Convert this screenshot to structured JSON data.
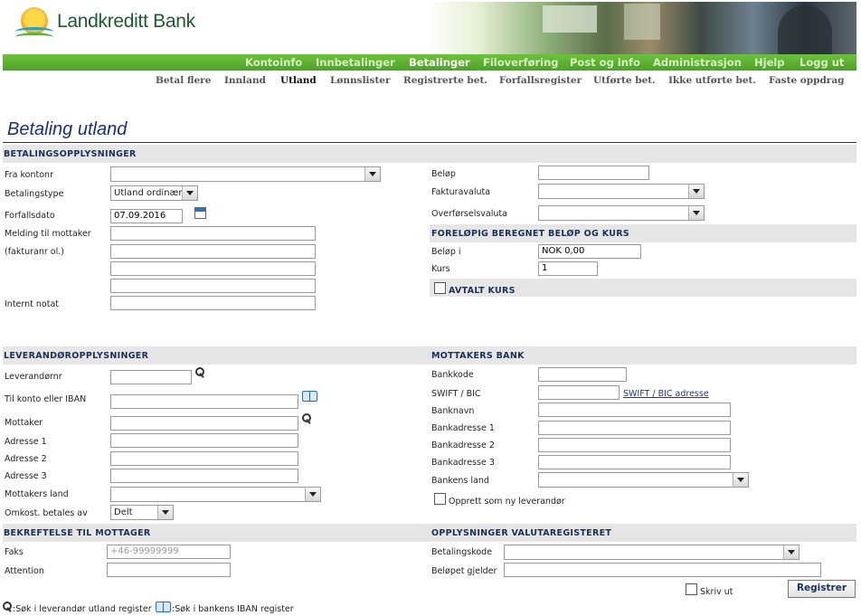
{
  "brand": {
    "name": "Landkreditt Bank"
  },
  "main_nav": [
    "Kontoinfo",
    "Innbetalinger",
    "Betalinger",
    "Filoverføring",
    "Post og info",
    "Administrasjon",
    "Hjelp",
    "Logg ut"
  ],
  "main_nav_active": "Betalinger",
  "sub_nav": [
    "Betal flere",
    "Innland",
    "Utland",
    "Lønnslister",
    "Registrerte bet.",
    "Forfallsregister",
    "Utførte bet.",
    "Ikke utførte bet.",
    "Faste oppdrag"
  ],
  "sub_nav_active": "Utland",
  "page_title": "Betaling utland",
  "betalingsopplysninger": {
    "title": "BETALINGSOPPLYSNINGER",
    "fra_kontonr_label": "Fra kontonr",
    "fra_kontonr_value": "",
    "betalingstype_label": "Betalingstype",
    "betalingstype_value": "Utland ordinær",
    "forfallsdato_label": "Forfallsdato",
    "forfallsdato_value": "07.09.2016",
    "melding_label_1": "Melding til mottaker",
    "melding_label_2": "(fakturanr ol.)",
    "internt_notat_label": "Internt notat",
    "belop_label": "Beløp",
    "fakturavaluta_label": "Fakturavaluta",
    "overforselsvaluta_label": "Overførselsvaluta"
  },
  "forelopig": {
    "title": "FORELØPIG BEREGNET BELØP OG KURS",
    "belop_i_label": "Beløp i",
    "belop_i_value": "NOK 0,00",
    "kurs_label": "Kurs",
    "kurs_value": "1",
    "avtalt_kurs_label": "AVTALT KURS"
  },
  "leverandor": {
    "title": "LEVERANDØROPPLYSNINGER",
    "leverandornr_label": "Leverandørnr",
    "til_konto_label": "Til konto eller IBAN",
    "mottaker_label": "Mottaker",
    "adresse1_label": "Adresse 1",
    "adresse2_label": "Adresse 2",
    "adresse3_label": "Adresse 3",
    "mottakers_land_label": "Mottakers land",
    "omkost_label": "Omkost. betales av",
    "omkost_value": "Delt"
  },
  "mottakers_bank": {
    "title": "MOTTAKERS BANK",
    "bankkode_label": "Bankkode",
    "swift_label": "SWIFT / BIC",
    "swift_link": "SWIFT / BIC adresse",
    "banknavn_label": "Banknavn",
    "bankadresse1_label": "Bankadresse 1",
    "bankadresse2_label": "Bankadresse 2",
    "bankadresse3_label": "Bankadresse 3",
    "bankens_land_label": "Bankens land",
    "opprett_label": "Opprett som ny leverandør"
  },
  "bekreftelse": {
    "title": "BEKREFTELSE TIL MOTTAGER",
    "faks_label": "Faks",
    "faks_placeholder": "+46-99999999",
    "attention_label": "Attention"
  },
  "valutaregister": {
    "title": "OPPLYSNINGER VALUTAREGISTERET",
    "betalingskode_label": "Betalingskode",
    "belopet_gjelder_label": "Beløpet gjelder"
  },
  "footer": {
    "skriv_ut_label": "Skriv ut",
    "registrer_button": "Registrer",
    "legend_leverandor": ":Søk i leverandør utland register",
    "legend_iban": ":Søk i bankens IBAN register"
  },
  "icons": [
    "key-icon",
    "book-icon",
    "calendar-icon",
    "chevron-down-icon"
  ]
}
